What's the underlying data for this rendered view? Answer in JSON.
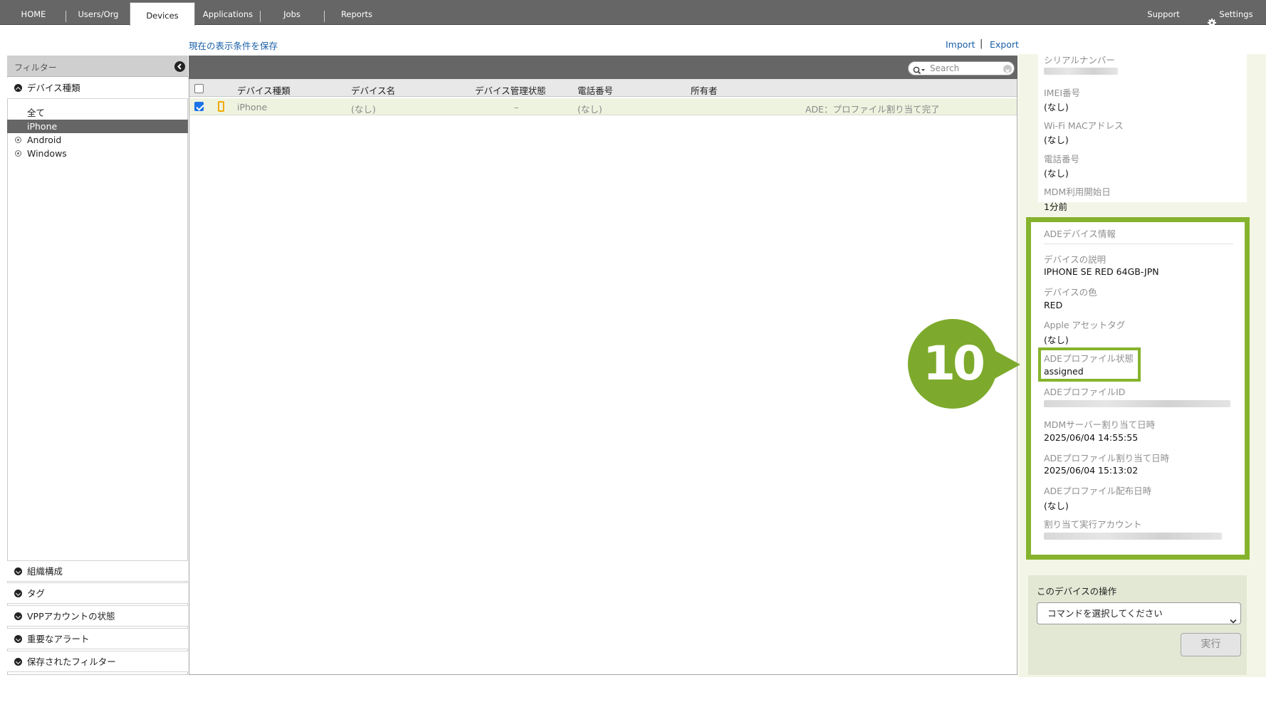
{
  "nav": {
    "tabs": [
      {
        "label": "HOME"
      },
      {
        "label": "Users/Org"
      },
      {
        "label": "Devices"
      },
      {
        "label": "Applications"
      },
      {
        "label": "Jobs"
      },
      {
        "label": "Reports"
      }
    ],
    "support": "Support",
    "settings": "Settings"
  },
  "toolbar": {
    "save_view": "現在の表示条件を保存",
    "import": "Import",
    "separator": "|",
    "export": "Export"
  },
  "sidebar": {
    "filter_title": "フィルター",
    "device_type_header": "デバイス種類",
    "items": [
      {
        "label": "全て"
      },
      {
        "label": "iPhone"
      },
      {
        "label": "Android"
      },
      {
        "label": "Windows"
      }
    ],
    "sections": [
      {
        "label": "組織構成"
      },
      {
        "label": "タグ"
      },
      {
        "label": "VPPアカウントの状態"
      },
      {
        "label": "重要なアラート"
      },
      {
        "label": "保存されたフィルター"
      }
    ]
  },
  "grid": {
    "search_placeholder": "Search",
    "columns": [
      "デバイス種類",
      "デバイス名",
      "デバイス管理状態",
      "電話番号",
      "所有者"
    ],
    "rows": [
      {
        "type": "iPhone",
        "name": "(なし)",
        "mgmt": "–",
        "phone": "(なし)",
        "status": "ADE：プロファイル割り当て完了"
      }
    ]
  },
  "details": {
    "top_fields": [
      {
        "label": "シリアルナンバー",
        "value": ""
      },
      {
        "label": "IMEI番号",
        "value": "(なし)"
      },
      {
        "label": "Wi-Fi MACアドレス",
        "value": "(なし)"
      },
      {
        "label": "電話番号",
        "value": "(なし)"
      },
      {
        "label": "MDM利用開始日",
        "value": "1分前"
      }
    ],
    "ade_title": "ADEデバイス情報",
    "ade_fields": [
      {
        "label": "デバイスの説明",
        "value": "IPHONE SE RED 64GB-JPN"
      },
      {
        "label": "デバイスの色",
        "value": "RED"
      },
      {
        "label": "Apple アセットタグ",
        "value": "(なし)"
      },
      {
        "label": "ADEプロファイル状態",
        "value": "assigned"
      },
      {
        "label": "ADEプロファイルID",
        "value": ""
      },
      {
        "label": "MDMサーバー割り当て日時",
        "value": "2025/06/04 14:55:55"
      },
      {
        "label": "ADEプロファイル割り当て日時",
        "value": "2025/06/04 15:13:02"
      },
      {
        "label": "ADEプロファイル配布日時",
        "value": "(なし)"
      },
      {
        "label": "割り当て実行アカウント",
        "value": ""
      }
    ]
  },
  "operations": {
    "title": "このデバイスの操作",
    "select_value": "コマンドを選択してください",
    "run_label": "実行"
  },
  "callout": {
    "number": "10"
  },
  "colors": {
    "accent_green": "#86b32d",
    "nav_gray": "#666666",
    "link_blue": "#1a5fa8"
  }
}
